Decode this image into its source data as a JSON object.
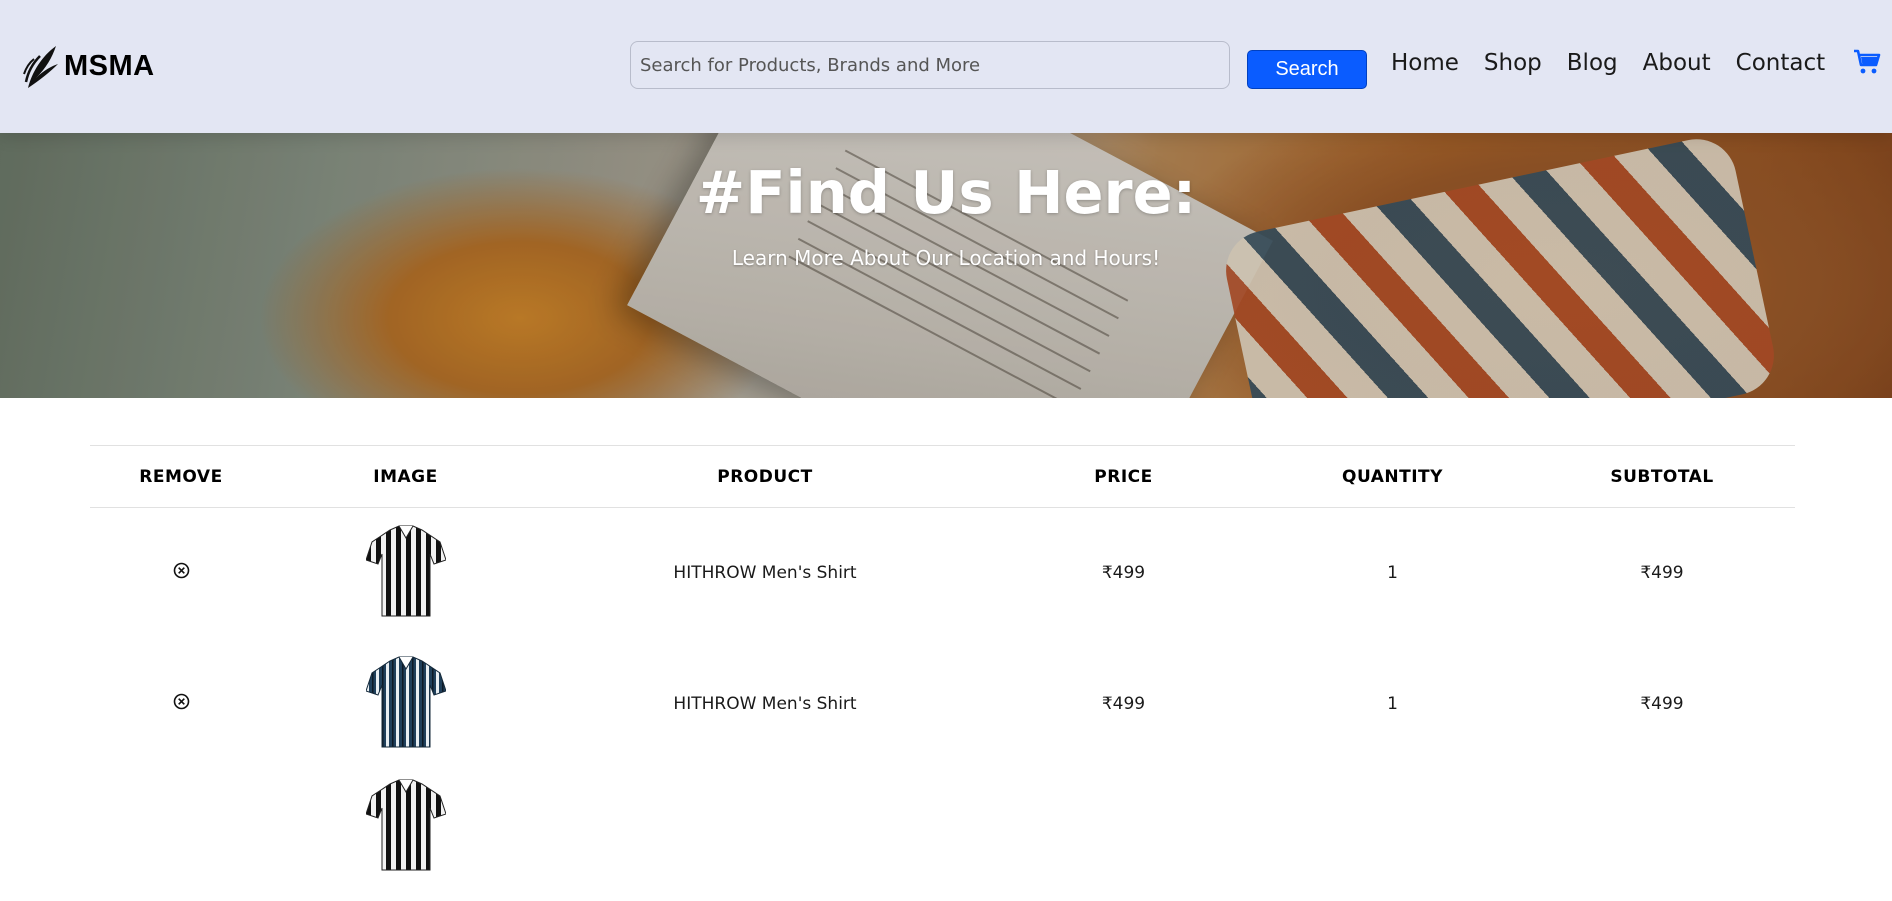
{
  "brand": {
    "name": "MSMA",
    "logo_icon": "leaf-plume-icon"
  },
  "search": {
    "placeholder": "Search for Products, Brands and More",
    "value": "",
    "button_label": "Search"
  },
  "nav": {
    "items": [
      "Home",
      "Shop",
      "Blog",
      "About",
      "Contact"
    ],
    "cart_icon": "cart-icon",
    "accent": "#0a5cff"
  },
  "hero": {
    "title": "#Find Us Here:",
    "subtitle": "Learn More About Our Location and Hours!"
  },
  "cart": {
    "columns": [
      "REMOVE",
      "IMAGE",
      "PRODUCT",
      "PRICE",
      "QUANTITY",
      "SUBTOTAL"
    ],
    "rows": [
      {
        "image": "shirt-black-white-stripe",
        "product": "HITHROW Men's Shirt",
        "price": "₹499",
        "quantity": "1",
        "subtotal": "₹499"
      },
      {
        "image": "shirt-blue-stripe",
        "product": "HITHROW Men's Shirt",
        "price": "₹499",
        "quantity": "1",
        "subtotal": "₹499"
      },
      {
        "image": "shirt-black-white-stripe",
        "product": "",
        "price": "",
        "quantity": "",
        "subtotal": ""
      }
    ]
  },
  "colors": {
    "header_bg": "#e3e6f3",
    "button_bg": "#0a5cff"
  }
}
